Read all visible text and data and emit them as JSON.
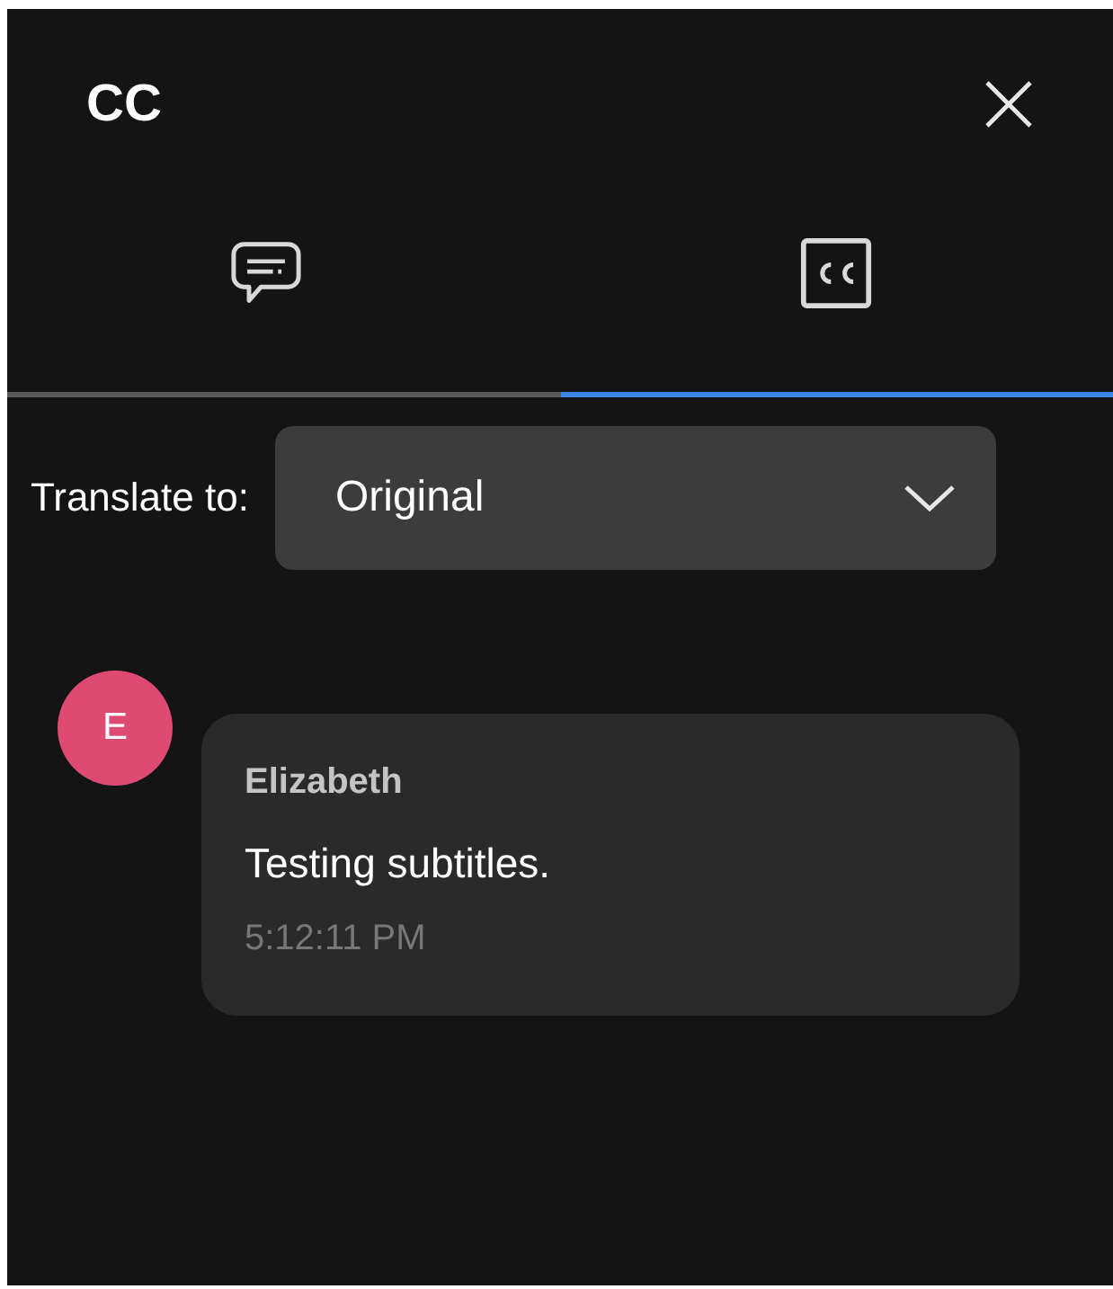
{
  "panel": {
    "title": "CC"
  },
  "tabs": [
    {
      "kind": "chat",
      "selected": false
    },
    {
      "kind": "captions",
      "selected": true
    }
  ],
  "translate": {
    "label": "Translate to:",
    "value": "Original"
  },
  "messages": [
    {
      "initial": "E",
      "color": "#df4a72",
      "sender": "Elizabeth",
      "text": "Testing subtitles.",
      "time": "5:12:11 PM"
    }
  ]
}
